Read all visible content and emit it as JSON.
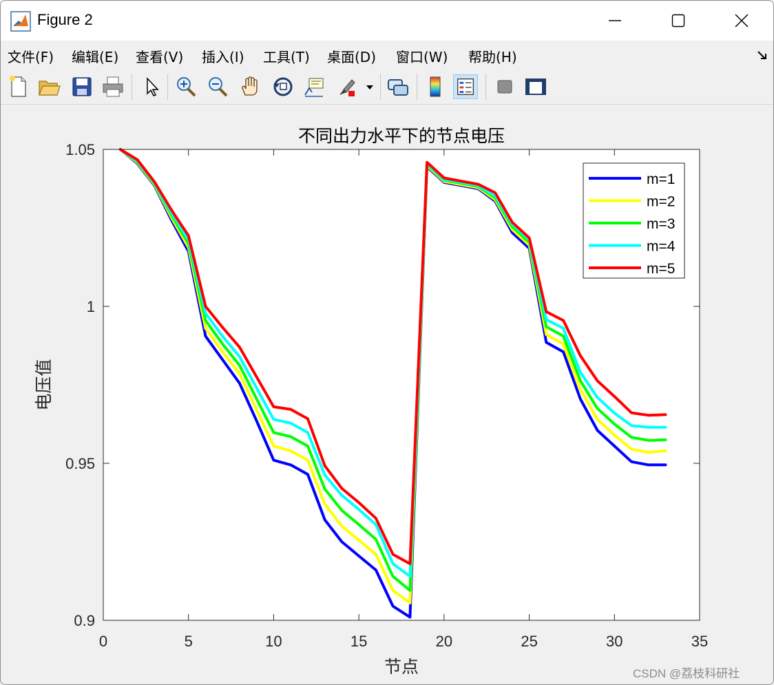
{
  "window": {
    "title": "Figure 2"
  },
  "menu": [
    "文件(F)",
    "编辑(E)",
    "查看(V)",
    "插入(I)",
    "工具(T)",
    "桌面(D)",
    "窗口(W)",
    "帮助(H)"
  ],
  "toolbar": {
    "buttons": [
      "new-figure-icon",
      "open-file-icon",
      "save-icon",
      "print-icon",
      "pointer-icon",
      "zoom-in-icon",
      "zoom-out-icon",
      "pan-icon",
      "rotate-3d-icon",
      "data-cursor-icon",
      "brush-icon",
      "link-plot-icon",
      "colorbar-icon",
      "legend-icon",
      "hide-plot-tools-icon",
      "show-plot-tools-icon"
    ]
  },
  "watermark": "CSDN @荔枝科研社",
  "chart_data": {
    "type": "line",
    "title": "不同出力水平下的节点电压",
    "xlabel": "节点",
    "ylabel": "电压值",
    "xlim": [
      0,
      35
    ],
    "ylim": [
      0.9,
      1.05
    ],
    "xticks": [
      "0",
      "5",
      "10",
      "15",
      "20",
      "25",
      "30",
      "35"
    ],
    "yticks": [
      "0.9",
      "0.95",
      "1",
      "1.05"
    ],
    "grid": false,
    "legend_position": "top-right",
    "x": [
      1,
      2,
      3,
      4,
      5,
      6,
      7,
      8,
      9,
      10,
      11,
      12,
      13,
      14,
      15,
      16,
      17,
      18,
      19,
      20,
      21,
      22,
      23,
      24,
      25,
      26,
      27,
      28,
      29,
      30,
      31,
      32,
      33
    ],
    "series": [
      {
        "name": "m=1",
        "color": "#0000ff",
        "values": [
          1.05,
          1.0455,
          1.0385,
          1.0275,
          1.0175,
          0.9905,
          0.983,
          0.9755,
          0.9635,
          0.951,
          0.9495,
          0.9465,
          0.932,
          0.925,
          0.9205,
          0.916,
          0.9045,
          0.901,
          1.0445,
          1.0395,
          1.0385,
          1.0375,
          1.0335,
          1.0235,
          1.0185,
          0.9885,
          0.9855,
          0.9705,
          0.9605,
          0.9555,
          0.9505,
          0.9495,
          0.9495
        ]
      },
      {
        "name": "m=2",
        "color": "#ffff00",
        "values": [
          1.05,
          1.0458,
          1.0388,
          1.0283,
          1.0188,
          0.993,
          0.9855,
          0.9785,
          0.967,
          0.9555,
          0.954,
          0.951,
          0.937,
          0.93,
          0.9255,
          0.921,
          0.9095,
          0.9055,
          1.0448,
          1.0398,
          1.0388,
          1.0378,
          1.034,
          1.0245,
          1.0195,
          0.991,
          0.988,
          0.9735,
          0.964,
          0.959,
          0.9545,
          0.9535,
          0.954
        ]
      },
      {
        "name": "m=3",
        "color": "#00ff00",
        "values": [
          1.05,
          1.0461,
          1.0391,
          1.0291,
          1.02,
          0.9955,
          0.988,
          0.9812,
          0.9705,
          0.9598,
          0.9585,
          0.9555,
          0.9418,
          0.935,
          0.9305,
          0.9258,
          0.914,
          0.9095,
          1.0452,
          1.0402,
          1.0392,
          1.0382,
          1.0346,
          1.0254,
          1.0204,
          0.9935,
          0.9905,
          0.9763,
          0.9675,
          0.9625,
          0.9583,
          0.9573,
          0.9575
        ]
      },
      {
        "name": "m=4",
        "color": "#00ffff",
        "values": [
          1.05,
          1.0464,
          1.0394,
          1.0298,
          1.0212,
          0.9978,
          0.9905,
          0.984,
          0.974,
          0.964,
          0.9628,
          0.9598,
          0.9463,
          0.9398,
          0.9353,
          0.9305,
          0.918,
          0.914,
          1.0455,
          1.0405,
          1.0395,
          1.0385,
          1.0352,
          1.0262,
          1.0212,
          0.9958,
          0.993,
          0.979,
          0.971,
          0.966,
          0.962,
          0.9615,
          0.9615
        ]
      },
      {
        "name": "m=5",
        "color": "#ff0000",
        "values": [
          1.05,
          1.0467,
          1.0397,
          1.0307,
          1.0225,
          1.0,
          0.9933,
          0.987,
          0.9775,
          0.968,
          0.9672,
          0.9642,
          0.9492,
          0.942,
          0.9375,
          0.9325,
          0.921,
          0.918,
          1.0459,
          1.0409,
          1.0399,
          1.0389,
          1.0362,
          1.0268,
          1.0218,
          0.9983,
          0.9955,
          0.9843,
          0.9763,
          0.9713,
          0.9661,
          0.9653,
          0.9655
        ]
      }
    ]
  }
}
